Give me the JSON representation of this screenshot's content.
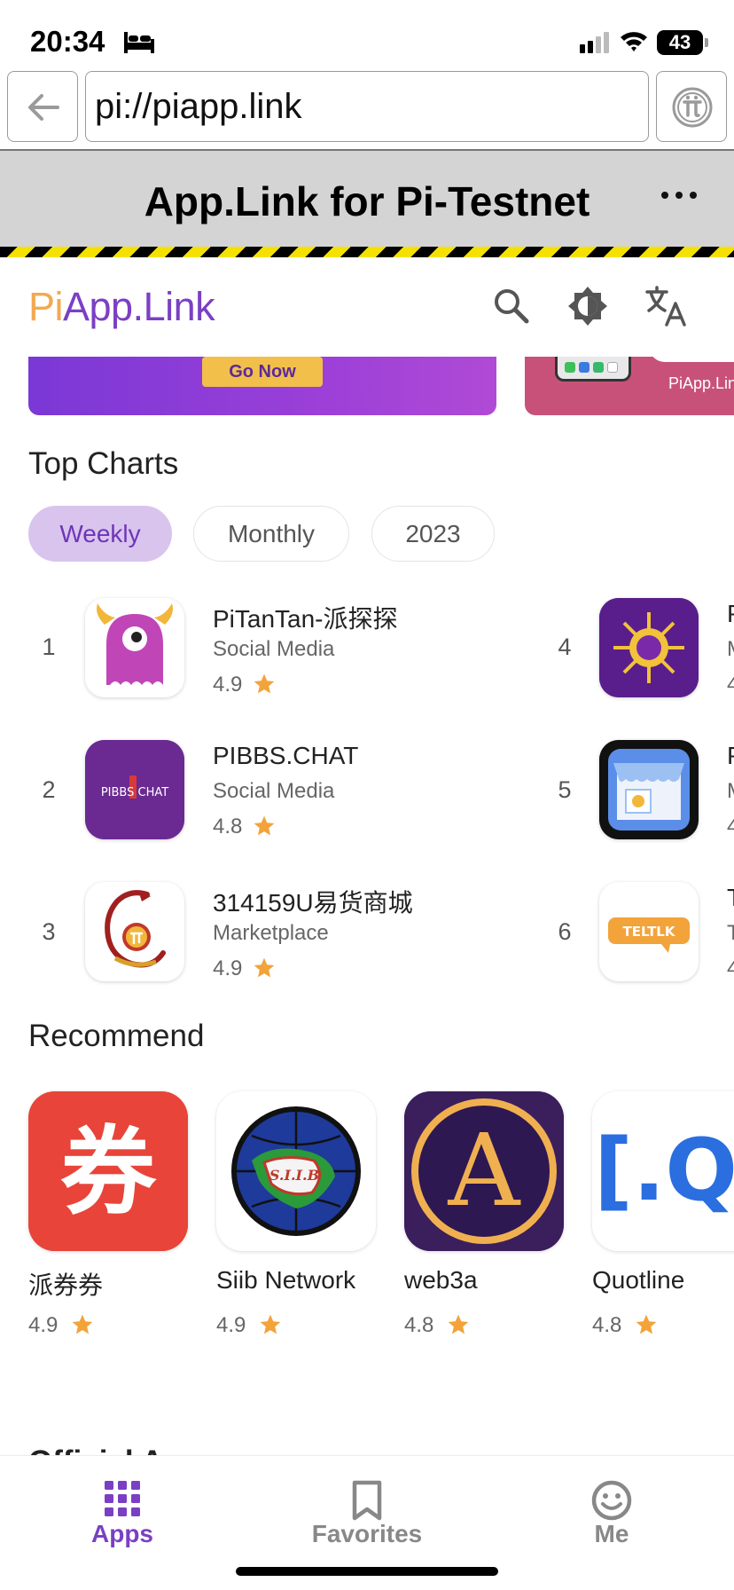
{
  "status_bar": {
    "time": "20:34",
    "battery": "43"
  },
  "browser": {
    "url": "pi://piapp.link"
  },
  "banner": {
    "title": "App.Link for Pi-Testnet"
  },
  "header": {
    "brand_pi": "Pi",
    "brand_rest": "App.Link"
  },
  "carousel": {
    "card1_button": "Go Now",
    "card2_text": "PiApp.Lin"
  },
  "top_charts": {
    "title": "Top Charts",
    "tabs": [
      {
        "label": "Weekly",
        "active": true
      },
      {
        "label": "Monthly",
        "active": false
      },
      {
        "label": "2023",
        "active": false
      }
    ],
    "apps": [
      {
        "rank": "1",
        "name": "PiTanTan-派探探",
        "category": "Social Media",
        "rating": "4.9"
      },
      {
        "rank": "2",
        "name": "PIBBS.CHAT",
        "category": "Social Media",
        "rating": "4.8"
      },
      {
        "rank": "3",
        "name": "314159U易货商城",
        "category": "Marketplace",
        "rating": "4.9"
      },
      {
        "rank": "4",
        "name": "P",
        "category": "M",
        "rating": "4"
      },
      {
        "rank": "5",
        "name": "P",
        "category": "M",
        "rating": "4"
      },
      {
        "rank": "6",
        "name": "T",
        "category": "T",
        "rating": "4"
      }
    ]
  },
  "recommend": {
    "title": "Recommend",
    "apps": [
      {
        "name": "派券券",
        "rating": "4.9",
        "icon_text": "券"
      },
      {
        "name": "Siib Network",
        "rating": "4.9",
        "icon_text": "S.I.I.B"
      },
      {
        "name": "web3a",
        "rating": "4.8",
        "icon_text": "A"
      },
      {
        "name": "Quotline",
        "rating": "4.8",
        "icon_text": "[.Q]"
      }
    ]
  },
  "icon_labels": {
    "pibbs": "PIBBS CHAT",
    "teltlk": "TELTLK"
  },
  "next_section_partial": "Official Apps",
  "bottom_nav": [
    {
      "label": "Apps",
      "icon": "apps-grid-icon",
      "active": true
    },
    {
      "label": "Favorites",
      "icon": "bookmark-icon",
      "active": false
    },
    {
      "label": "Me",
      "icon": "smiley-icon",
      "active": false
    }
  ],
  "colors": {
    "accent": "#7b3fc4",
    "brand_pi": "#f2a950",
    "star": "#f2a33a",
    "chip_active_bg": "#d9c4ee"
  }
}
